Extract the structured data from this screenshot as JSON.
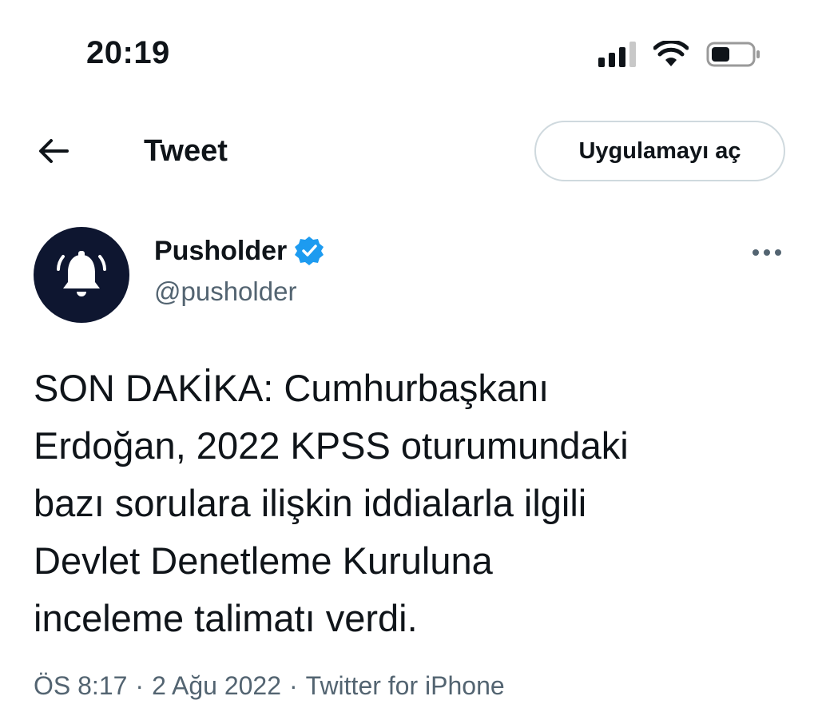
{
  "status_bar": {
    "time": "20:19",
    "icons": [
      "cellular-signal-icon",
      "wifi-icon",
      "battery-icon"
    ]
  },
  "header": {
    "title": "Tweet",
    "back_icon": "back-arrow-icon",
    "open_app_label": "Uygulamayı aç"
  },
  "author": {
    "name": "Pusholder",
    "handle": "@pusholder",
    "verified": true,
    "avatar_icon": "bell-icon"
  },
  "tweet": {
    "text": "SON DAKİKA: Cumhurbaşkanı\nErdoğan, 2022 KPSS oturumundaki\nbazı sorulara ilişkin iddialarla ilgili\nDevlet Denetleme Kuruluna\ninceleme talimatı verdi.",
    "time": "ÖS 8:17",
    "date": "2 Ağu 2022",
    "source": "Twitter for iPhone",
    "separator": "·"
  },
  "colors": {
    "text": "#0f1419",
    "secondary": "#536471",
    "verified": "#1d9bf0",
    "avatar_bg": "#0e1630",
    "button_border": "#cfd9de"
  }
}
